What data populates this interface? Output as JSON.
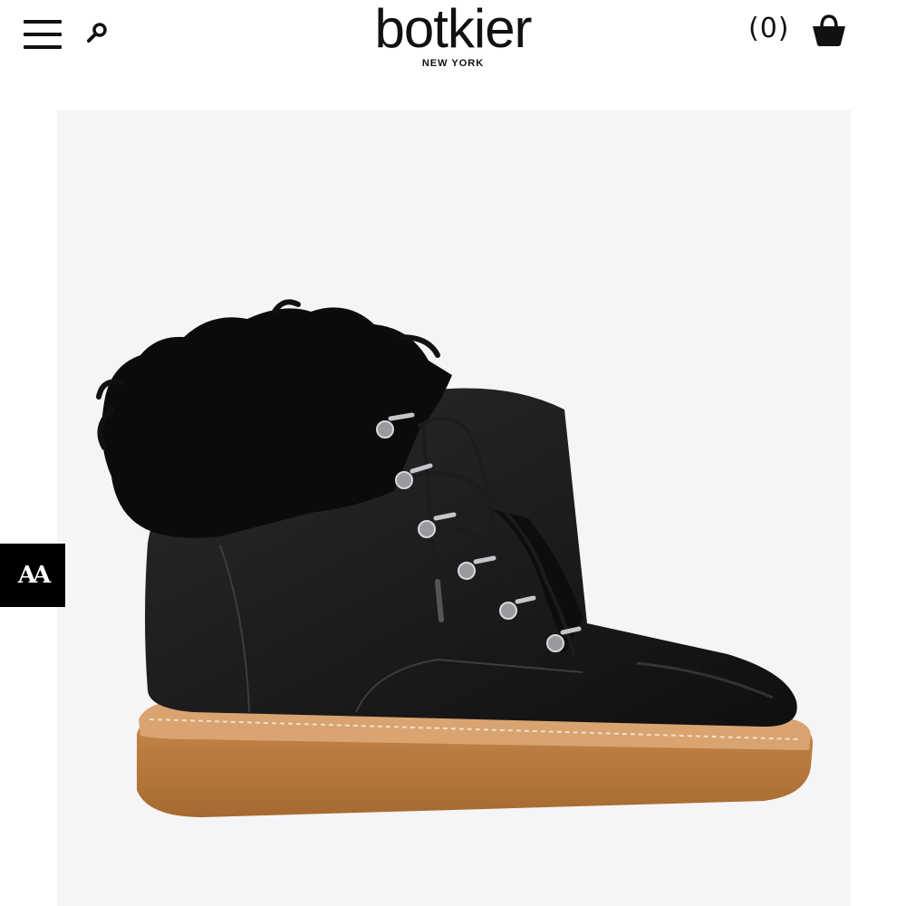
{
  "header": {
    "logo": {
      "wordmark": "botkier",
      "subtitle": "NEW YORK"
    },
    "cart": {
      "count_label": "(0)"
    },
    "icons": {
      "menu": "hamburger-menu-icon",
      "search": "search-icon",
      "cart": "shopping-basket-icon"
    }
  },
  "accessibility": {
    "button_label": "AA"
  },
  "product": {
    "image": "black-leather-lace-up-boot-with-fur-collar"
  },
  "colors": {
    "background": "#ffffff",
    "image_background": "#f5f5f7",
    "text": "#111111",
    "accessibility_button": "#000000"
  }
}
